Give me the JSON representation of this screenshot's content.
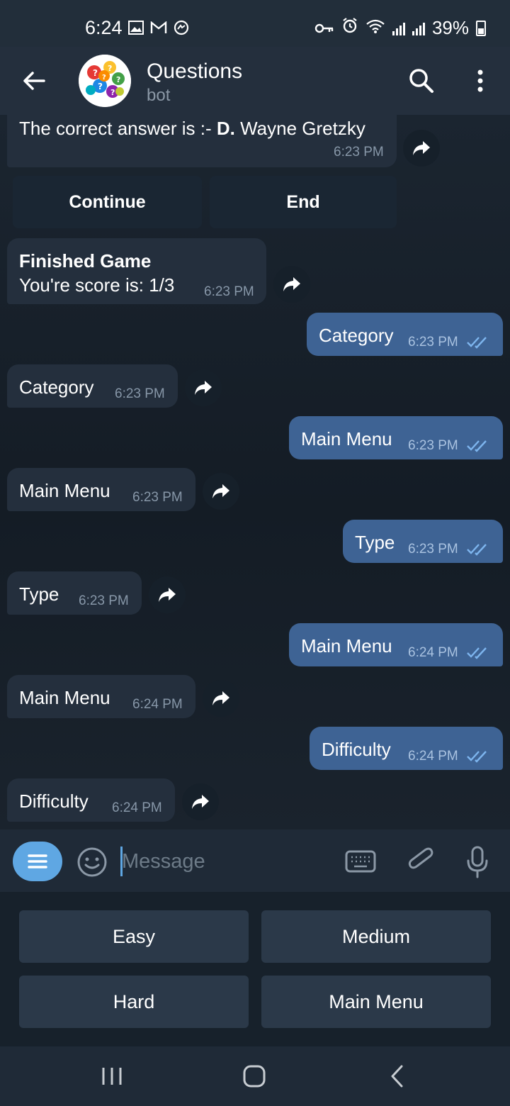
{
  "status_bar": {
    "time": "6:24",
    "battery": "39%"
  },
  "header": {
    "title": "Questions",
    "subtitle": "bot"
  },
  "inline_keyboard": {
    "continue_label": "Continue",
    "end_label": "End"
  },
  "messages": [
    {
      "dir": "in",
      "text_prefix": "The correct answer is :- ",
      "text_bold": "D.",
      "text_suffix": " Wayne Gretzky",
      "time": "6:23 PM"
    },
    {
      "dir": "in",
      "line1": "Finished Game",
      "line2": "You're score is: 1/3",
      "time": "6:23 PM"
    },
    {
      "dir": "out",
      "text": "Category",
      "time": "6:23 PM"
    },
    {
      "dir": "in",
      "text": "Category",
      "time": "6:23 PM"
    },
    {
      "dir": "out",
      "text": "Main Menu",
      "time": "6:23 PM"
    },
    {
      "dir": "in",
      "text": "Main Menu",
      "time": "6:23 PM"
    },
    {
      "dir": "out",
      "text": "Type",
      "time": "6:23 PM"
    },
    {
      "dir": "in",
      "text": "Type",
      "time": "6:23 PM"
    },
    {
      "dir": "out",
      "text": "Main Menu",
      "time": "6:24 PM"
    },
    {
      "dir": "in",
      "text": "Main Menu",
      "time": "6:24 PM"
    },
    {
      "dir": "out",
      "text": "Difficulty",
      "time": "6:24 PM"
    },
    {
      "dir": "in",
      "text": "Difficulty",
      "time": "6:24 PM"
    }
  ],
  "composer": {
    "placeholder": "Message"
  },
  "reply_keyboard": {
    "buttons": [
      "Easy",
      "Medium",
      "Hard",
      "Main Menu"
    ]
  },
  "colors": {
    "accent": "#5fa7e3",
    "outgoing_bubble": "#3e6394",
    "incoming_bubble": "#242f3d",
    "background": "#17212b"
  }
}
